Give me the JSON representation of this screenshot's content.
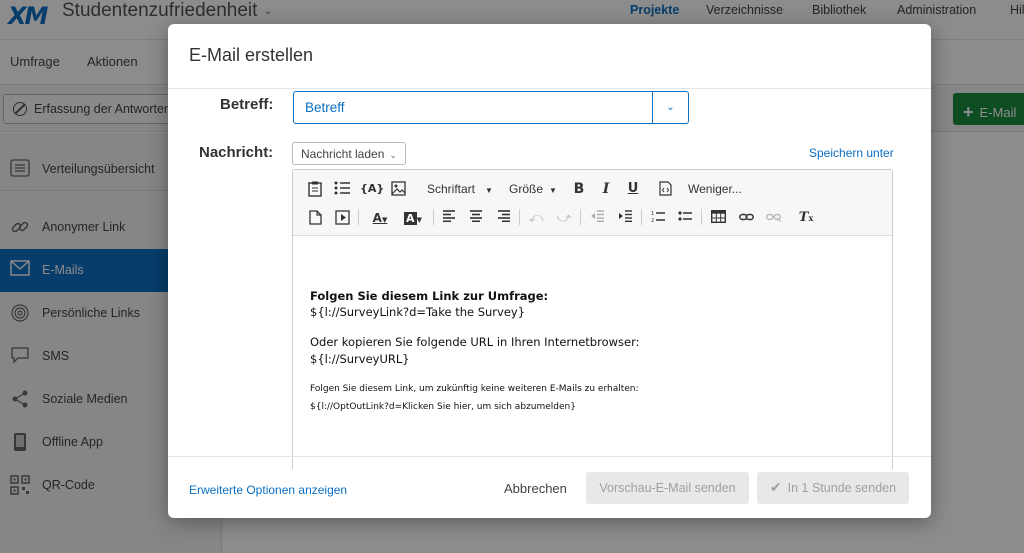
{
  "app": {
    "logo": "XM",
    "project_title": "Studentenzufriedenheit",
    "top_nav": [
      {
        "label": "Projekte",
        "active": true
      },
      {
        "label": "Verzeichnisse",
        "active": false
      },
      {
        "label": "Bibliothek",
        "active": false
      },
      {
        "label": "Administration",
        "active": false
      },
      {
        "label": "Hil",
        "active": false
      }
    ],
    "sub_tabs": [
      "Umfrage",
      "Aktionen"
    ],
    "responses_button": "Erfassung der Antworten",
    "new_email_button": "E-Mail",
    "sidebar": [
      {
        "label": "Verteilungsübersicht",
        "icon": "list-icon"
      },
      {
        "label": "Anonymer Link",
        "icon": "link-icon"
      },
      {
        "label": "E-Mails",
        "icon": "envelope-icon",
        "active": true
      },
      {
        "label": "Persönliche Links",
        "icon": "fingerprint-icon"
      },
      {
        "label": "SMS",
        "icon": "chat-bubble-icon"
      },
      {
        "label": "Soziale Medien",
        "icon": "share-icon"
      },
      {
        "label": "Offline App",
        "icon": "tablet-icon"
      },
      {
        "label": "QR-Code",
        "icon": "qr-code-icon"
      }
    ]
  },
  "modal": {
    "title": "E-Mail erstellen",
    "subject_label": "Betreff:",
    "subject_value": "Betreff",
    "message_label": "Nachricht:",
    "load_message_button": "Nachricht laden",
    "save_under_link": "Speichern unter",
    "toolbar": {
      "font_label": "Schriftart",
      "size_label": "Größe",
      "less_label": "Weniger..."
    },
    "body": {
      "heading": "Folgen Sie diesem Link zur Umfrage:",
      "survey_link": "${l://SurveyLink?d=Take the Survey}",
      "copy_text": "Oder kopieren Sie folgende URL in Ihren Internetbrowser:",
      "survey_url": "${l://SurveyURL}",
      "optout_text": "Folgen Sie diesem Link, um zukünftig keine weiteren E-Mails zu erhalten:",
      "optout_link": "${l://OptOutLink?d=Klicken Sie hier, um sich abzumelden}"
    },
    "footer": {
      "advanced_link": "Erweiterte Optionen anzeigen",
      "cancel_button": "Abbrechen",
      "preview_button": "Vorschau-E-Mail senden",
      "send_button": "In 1 Stunde senden"
    }
  },
  "colors": {
    "accent": "#0b6fc2",
    "primary_green": "#1a8a3c",
    "overlay": "rgba(0,0,0,0.45)"
  }
}
